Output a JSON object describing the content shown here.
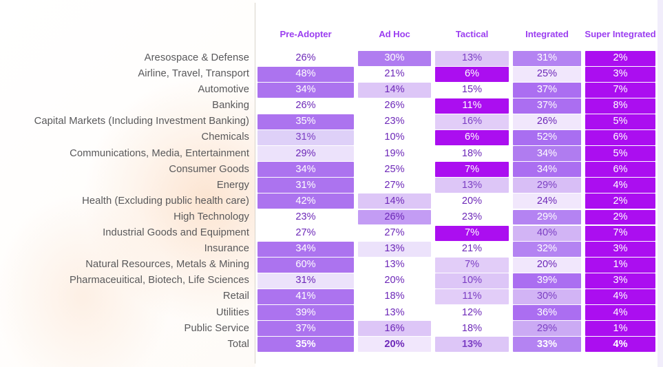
{
  "chart_data": {
    "type": "heatmap",
    "title": "",
    "xlabel": "",
    "ylabel": "",
    "legend_position": "none",
    "grid": false,
    "columns": [
      "Pre-Adopter",
      "Ad Hoc",
      "Tactical",
      "Integrated",
      "Super Integrated"
    ],
    "categories": [
      "Aresospace & Defense",
      "Airline, Travel, Transport",
      "Automotive",
      "Banking",
      "Capital Markets (Including Investment Banking)",
      "Chemicals",
      "Communications, Media, Entertainment",
      "Consumer Goods",
      "Energy",
      "Health (Excluding public health care)",
      "High Technology",
      "Industrial Goods and Equipment",
      "Insurance",
      "Natural Resources, Metals & Mining",
      "Pharmaceuitical, Biotech, Life Sciences",
      "Retail",
      "Utilities",
      "Public Service",
      "Total"
    ],
    "series": [
      {
        "name": "Pre-Adopter",
        "values": [
          26,
          48,
          34,
          26,
          35,
          31,
          29,
          34,
          31,
          42,
          23,
          27,
          34,
          60,
          31,
          41,
          39,
          37,
          35
        ]
      },
      {
        "name": "Ad Hoc",
        "values": [
          30,
          21,
          14,
          26,
          23,
          10,
          19,
          25,
          27,
          14,
          26,
          27,
          13,
          13,
          20,
          18,
          13,
          16,
          20
        ]
      },
      {
        "name": "Tactical",
        "values": [
          13,
          6,
          15,
          11,
          16,
          6,
          18,
          7,
          13,
          20,
          23,
          7,
          21,
          7,
          10,
          11,
          12,
          18,
          13
        ]
      },
      {
        "name": "Integrated",
        "values": [
          31,
          25,
          37,
          37,
          26,
          52,
          34,
          34,
          29,
          24,
          29,
          40,
          32,
          20,
          39,
          30,
          36,
          29,
          33
        ]
      },
      {
        "name": "Super Integrated",
        "values": [
          2,
          3,
          7,
          8,
          5,
          6,
          5,
          6,
          4,
          2,
          2,
          7,
          3,
          1,
          3,
          4,
          4,
          1,
          4
        ]
      }
    ],
    "units": "%"
  },
  "table": {
    "headers": [
      "Pre-Adopter",
      "Ad Hoc",
      "Tactical",
      "Integrated",
      "Super Integrated"
    ],
    "header_color": "#9b3ef0",
    "rows": [
      {
        "label": "Aresospace & Defense",
        "total": false,
        "cells": [
          {
            "text": "26%",
            "fill": "#ffffff",
            "color": "#6d28b8"
          },
          {
            "text": "30%",
            "fill": "#b07cf0",
            "color": "#ffffff"
          },
          {
            "text": "13%",
            "fill": "#ddc6f7",
            "color": "#7c3fc4"
          },
          {
            "text": "31%",
            "fill": "#b483f2",
            "color": "#ffffff"
          },
          {
            "text": "2%",
            "fill": "#ab0ef0",
            "color": "#ffffff"
          }
        ]
      },
      {
        "label": "Airline, Travel, Transport",
        "total": false,
        "cells": [
          {
            "text": "48%",
            "fill": "#ac73ef",
            "color": "#ffffff"
          },
          {
            "text": "21%",
            "fill": "#ffffff",
            "color": "#6d28b8"
          },
          {
            "text": "6%",
            "fill": "#ab0ef0",
            "color": "#ffffff"
          },
          {
            "text": "25%",
            "fill": "#f1e7fc",
            "color": "#6d28b8"
          },
          {
            "text": "3%",
            "fill": "#ab0ef0",
            "color": "#ffffff"
          }
        ]
      },
      {
        "label": "Automotive",
        "total": false,
        "cells": [
          {
            "text": "34%",
            "fill": "#ac73ef",
            "color": "#ffffff"
          },
          {
            "text": "14%",
            "fill": "#ddc6f7",
            "color": "#6d28b8"
          },
          {
            "text": "15%",
            "fill": "#ffffff",
            "color": "#6d28b8"
          },
          {
            "text": "37%",
            "fill": "#ab6ef1",
            "color": "#ffffff"
          },
          {
            "text": "7%",
            "fill": "#ab0ef0",
            "color": "#ffffff"
          }
        ]
      },
      {
        "label": "Banking",
        "total": false,
        "cells": [
          {
            "text": "26%",
            "fill": "#ffffff",
            "color": "#6d28b8"
          },
          {
            "text": "26%",
            "fill": "#ffffff",
            "color": "#6d28b8"
          },
          {
            "text": "11%",
            "fill": "#ab0ef0",
            "color": "#ffffff"
          },
          {
            "text": "37%",
            "fill": "#ab6ef1",
            "color": "#ffffff"
          },
          {
            "text": "8%",
            "fill": "#ab0ef0",
            "color": "#ffffff"
          }
        ]
      },
      {
        "label": "Capital Markets (Including Investment Banking)",
        "total": false,
        "cells": [
          {
            "text": "35%",
            "fill": "#ac73ef",
            "color": "#ffffff"
          },
          {
            "text": "23%",
            "fill": "#ffffff",
            "color": "#6d28b8"
          },
          {
            "text": "16%",
            "fill": "#e2cdf8",
            "color": "#7c3fc4"
          },
          {
            "text": "26%",
            "fill": "#f1e7fc",
            "color": "#6d28b8"
          },
          {
            "text": "5%",
            "fill": "#ab0ef0",
            "color": "#ffffff"
          }
        ]
      },
      {
        "label": "Chemicals",
        "total": false,
        "cells": [
          {
            "text": "31%",
            "fill": "#ded0f8",
            "color": "#7c3fc4"
          },
          {
            "text": "10%",
            "fill": "#ffffff",
            "color": "#6d28b8"
          },
          {
            "text": "6%",
            "fill": "#ab0ef0",
            "color": "#ffffff"
          },
          {
            "text": "52%",
            "fill": "#a96ef1",
            "color": "#ffffff"
          },
          {
            "text": "6%",
            "fill": "#ab0ef0",
            "color": "#ffffff"
          }
        ]
      },
      {
        "label": "Communications, Media, Entertainment",
        "total": false,
        "cells": [
          {
            "text": "29%",
            "fill": "#ece2fb",
            "color": "#6d28b8"
          },
          {
            "text": "19%",
            "fill": "#ffffff",
            "color": "#6d28b8"
          },
          {
            "text": "18%",
            "fill": "#ffffff",
            "color": "#6d28b8"
          },
          {
            "text": "34%",
            "fill": "#b07cf0",
            "color": "#ffffff"
          },
          {
            "text": "5%",
            "fill": "#ab0ef0",
            "color": "#ffffff"
          }
        ]
      },
      {
        "label": "Consumer Goods",
        "total": false,
        "cells": [
          {
            "text": "34%",
            "fill": "#ac73ef",
            "color": "#ffffff"
          },
          {
            "text": "25%",
            "fill": "#ffffff",
            "color": "#6d28b8"
          },
          {
            "text": "7%",
            "fill": "#ab0ef0",
            "color": "#ffffff"
          },
          {
            "text": "34%",
            "fill": "#ab6ef1",
            "color": "#ffffff"
          },
          {
            "text": "6%",
            "fill": "#ab0ef0",
            "color": "#ffffff"
          }
        ]
      },
      {
        "label": "Energy",
        "total": false,
        "cells": [
          {
            "text": "31%",
            "fill": "#ac73ef",
            "color": "#ffffff"
          },
          {
            "text": "27%",
            "fill": "#ffffff",
            "color": "#6d28b8"
          },
          {
            "text": "13%",
            "fill": "#ddc6f7",
            "color": "#7c3fc4"
          },
          {
            "text": "29%",
            "fill": "#d8bef6",
            "color": "#7c3fc4"
          },
          {
            "text": "4%",
            "fill": "#ab0ef0",
            "color": "#ffffff"
          }
        ]
      },
      {
        "label": "Health (Excluding public health care)",
        "total": false,
        "cells": [
          {
            "text": "42%",
            "fill": "#ac73ef",
            "color": "#ffffff"
          },
          {
            "text": "14%",
            "fill": "#ddc6f7",
            "color": "#6d28b8"
          },
          {
            "text": "20%",
            "fill": "#ffffff",
            "color": "#6d28b8"
          },
          {
            "text": "24%",
            "fill": "#f1e7fc",
            "color": "#6d28b8"
          },
          {
            "text": "2%",
            "fill": "#ab0ef0",
            "color": "#ffffff"
          }
        ]
      },
      {
        "label": "High Technology",
        "total": false,
        "cells": [
          {
            "text": "23%",
            "fill": "#ffffff",
            "color": "#6d28b8"
          },
          {
            "text": "26%",
            "fill": "#c39cf4",
            "color": "#6d28b8"
          },
          {
            "text": "23%",
            "fill": "#ffffff",
            "color": "#6d28b8"
          },
          {
            "text": "29%",
            "fill": "#b483f2",
            "color": "#ffffff"
          },
          {
            "text": "2%",
            "fill": "#ab0ef0",
            "color": "#ffffff"
          }
        ]
      },
      {
        "label": "Industrial Goods and Equipment",
        "total": false,
        "cells": [
          {
            "text": "27%",
            "fill": "#ffffff",
            "color": "#6d28b8"
          },
          {
            "text": "27%",
            "fill": "#ffffff",
            "color": "#6d28b8"
          },
          {
            "text": "7%",
            "fill": "#ab0ef0",
            "color": "#ffffff"
          },
          {
            "text": "40%",
            "fill": "#d2b4f5",
            "color": "#7c3fc4"
          },
          {
            "text": "7%",
            "fill": "#ab0ef0",
            "color": "#ffffff"
          }
        ]
      },
      {
        "label": "Insurance",
        "total": false,
        "cells": [
          {
            "text": "34%",
            "fill": "#ac73ef",
            "color": "#ffffff"
          },
          {
            "text": "13%",
            "fill": "#ece2fb",
            "color": "#6d28b8"
          },
          {
            "text": "21%",
            "fill": "#ffffff",
            "color": "#6d28b8"
          },
          {
            "text": "32%",
            "fill": "#b483f2",
            "color": "#ffffff"
          },
          {
            "text": "3%",
            "fill": "#ab0ef0",
            "color": "#ffffff"
          }
        ]
      },
      {
        "label": "Natural Resources, Metals & Mining",
        "total": false,
        "cells": [
          {
            "text": "60%",
            "fill": "#ac73ef",
            "color": "#ffffff"
          },
          {
            "text": "13%",
            "fill": "#ffffff",
            "color": "#6d28b8"
          },
          {
            "text": "7%",
            "fill": "#e2cdf8",
            "color": "#7c3fc4"
          },
          {
            "text": "20%",
            "fill": "#f1e7fc",
            "color": "#6d28b8"
          },
          {
            "text": "1%",
            "fill": "#ab0ef0",
            "color": "#ffffff"
          }
        ]
      },
      {
        "label": "Pharmaceuitical, Biotech, Life Sciences",
        "total": false,
        "cells": [
          {
            "text": "31%",
            "fill": "#ece2fb",
            "color": "#6d28b8"
          },
          {
            "text": "20%",
            "fill": "#ffffff",
            "color": "#6d28b8"
          },
          {
            "text": "10%",
            "fill": "#ddc6f7",
            "color": "#7c3fc4"
          },
          {
            "text": "39%",
            "fill": "#ab6ef1",
            "color": "#ffffff"
          },
          {
            "text": "3%",
            "fill": "#ab0ef0",
            "color": "#ffffff"
          }
        ]
      },
      {
        "label": "Retail",
        "total": false,
        "cells": [
          {
            "text": "41%",
            "fill": "#ac73ef",
            "color": "#ffffff"
          },
          {
            "text": "18%",
            "fill": "#ffffff",
            "color": "#6d28b8"
          },
          {
            "text": "11%",
            "fill": "#e2cdf8",
            "color": "#7c3fc4"
          },
          {
            "text": "30%",
            "fill": "#d2b4f5",
            "color": "#7c3fc4"
          },
          {
            "text": "4%",
            "fill": "#ab0ef0",
            "color": "#ffffff"
          }
        ]
      },
      {
        "label": "Utilities",
        "total": false,
        "cells": [
          {
            "text": "39%",
            "fill": "#ac73ef",
            "color": "#ffffff"
          },
          {
            "text": "13%",
            "fill": "#ffffff",
            "color": "#6d28b8"
          },
          {
            "text": "12%",
            "fill": "#ffffff",
            "color": "#6d28b8"
          },
          {
            "text": "36%",
            "fill": "#ab6ef1",
            "color": "#ffffff"
          },
          {
            "text": "4%",
            "fill": "#ab0ef0",
            "color": "#ffffff"
          }
        ]
      },
      {
        "label": "Public Service",
        "total": false,
        "cells": [
          {
            "text": "37%",
            "fill": "#ac73ef",
            "color": "#ffffff"
          },
          {
            "text": "16%",
            "fill": "#ddc6f7",
            "color": "#6d28b8"
          },
          {
            "text": "18%",
            "fill": "#ffffff",
            "color": "#6d28b8"
          },
          {
            "text": "29%",
            "fill": "#cbaaf4",
            "color": "#7c3fc4"
          },
          {
            "text": "1%",
            "fill": "#ab0ef0",
            "color": "#ffffff"
          }
        ]
      },
      {
        "label": "Total",
        "total": true,
        "cells": [
          {
            "text": "35%",
            "fill": "#ac73ef",
            "color": "#ffffff"
          },
          {
            "text": "20%",
            "fill": "#f1e7fc",
            "color": "#6d28b8"
          },
          {
            "text": "13%",
            "fill": "#ddc6f7",
            "color": "#7c3fc4"
          },
          {
            "text": "33%",
            "fill": "#b483f2",
            "color": "#ffffff"
          },
          {
            "text": "4%",
            "fill": "#ab0ef0",
            "color": "#ffffff"
          }
        ]
      }
    ]
  }
}
